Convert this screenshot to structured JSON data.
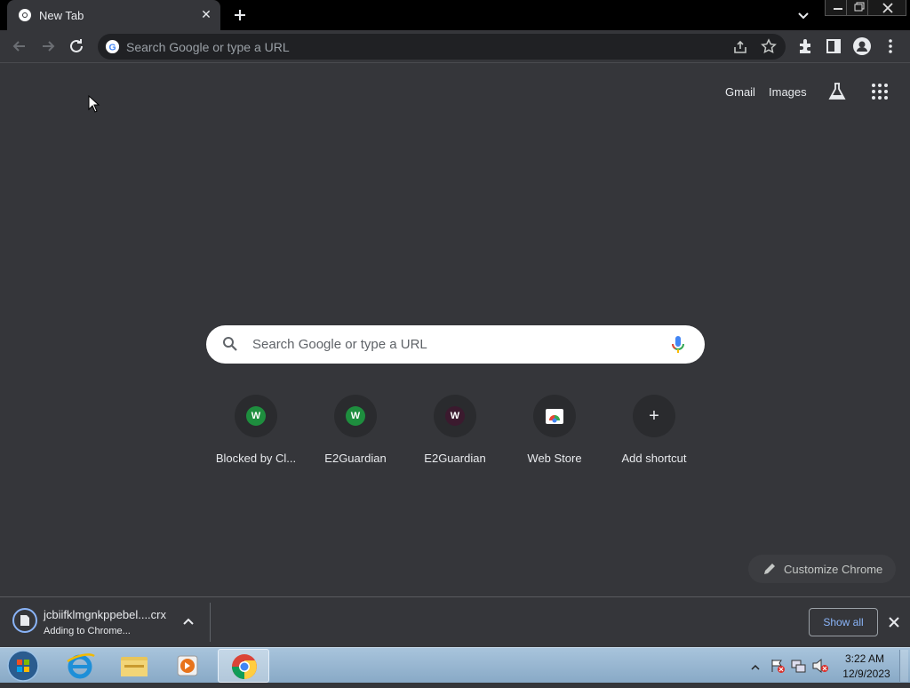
{
  "tab": {
    "title": "New Tab"
  },
  "omnibox": {
    "placeholder": "Search Google or type a URL"
  },
  "ntp": {
    "links": {
      "gmail": "Gmail",
      "images": "Images"
    },
    "search_placeholder": "Search Google or type a URL",
    "shortcuts": [
      {
        "label": "Blocked by Cl...",
        "letter": "W",
        "color": "#1e8e3e"
      },
      {
        "label": "E2Guardian",
        "letter": "W",
        "color": "#1e8e3e"
      },
      {
        "label": "E2Guardian",
        "letter": "W",
        "color": "#3b1a2e"
      },
      {
        "label": "Web Store",
        "letter": "",
        "color": "#ffffff"
      },
      {
        "label": "Add shortcut",
        "letter": "+",
        "color": "#3c3d41"
      }
    ],
    "customize_label": "Customize Chrome"
  },
  "download": {
    "filename": "jcbiifklmgnkppebel....crx",
    "status": "Adding to Chrome...",
    "show_all": "Show all"
  },
  "taskbar": {
    "time": "3:22 AM",
    "date": "12/9/2023"
  }
}
